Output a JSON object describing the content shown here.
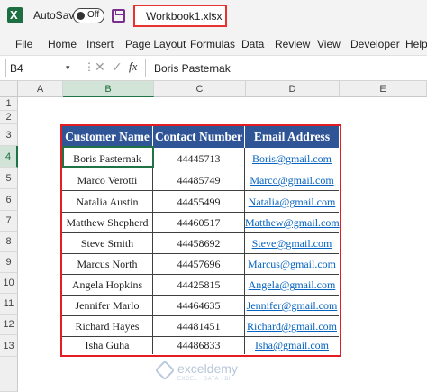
{
  "title_bar": {
    "autosave_label": "AutoSave",
    "autosave_state": "Off",
    "workbook_name": "Workbook1.xlsx"
  },
  "menu": [
    "File",
    "Home",
    "Insert",
    "Page Layout",
    "Formulas",
    "Data",
    "Review",
    "View",
    "Developer",
    "Help"
  ],
  "formula_bar": {
    "name_box": "B4",
    "fx": "fx",
    "value": "Boris Pasternak"
  },
  "grid": {
    "columns": [
      "A",
      "B",
      "C",
      "D",
      "E"
    ],
    "rows": [
      "1",
      "2",
      "3",
      "4",
      "5",
      "6",
      "7",
      "8",
      "9",
      "10",
      "11",
      "12",
      "13"
    ],
    "selected_column": "B",
    "selected_row": "4"
  },
  "table": {
    "headers": [
      "Customer Name",
      "Contact Number",
      "Email Address"
    ],
    "rows": [
      [
        "Boris Pasternak",
        "44445713",
        "Boris@gmail.com"
      ],
      [
        "Marco Verotti",
        "44485749",
        "Marco@gmail.com"
      ],
      [
        "Natalia Austin",
        "44455499",
        "Natalia@gmail.com"
      ],
      [
        "Matthew Shepherd",
        "44460517",
        "Matthew@gmail.com"
      ],
      [
        "Steve Smith",
        "44458692",
        "Steve@gmail.com"
      ],
      [
        "Marcus North",
        "44457696",
        "Marcus@gmail.com"
      ],
      [
        "Angela Hopkins",
        "44425815",
        "Angela@gmail.com"
      ],
      [
        "Jennifer Marlo",
        "44464635",
        "Jennifer@gmail.com"
      ],
      [
        "Richard Hayes",
        "44481451",
        "Richard@gmail.com"
      ],
      [
        "Isha Guha",
        "44486833",
        "Isha@gmail.com"
      ]
    ]
  },
  "watermark": {
    "name": "exceldemy",
    "tagline": "EXCEL · DATA · BI"
  },
  "colors": {
    "header_fill": "#2f5597",
    "table_border": "#e21d23",
    "selection": "#217346",
    "link": "#0563c1"
  }
}
